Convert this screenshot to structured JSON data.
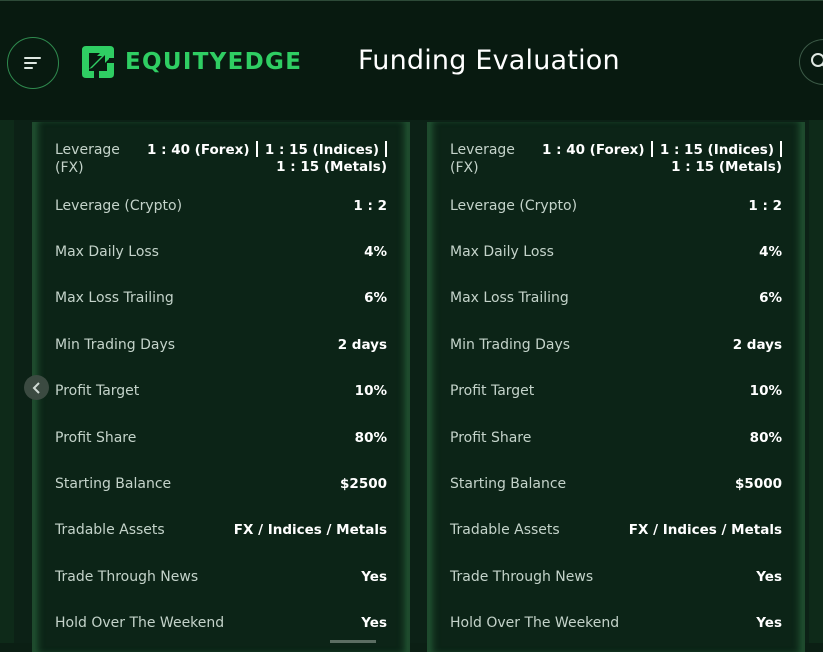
{
  "header": {
    "logo_text": "EQUITYEDGE",
    "page_title": "Funding Evaluation",
    "menu_icon": "hamburger-menu-icon",
    "search_icon": "search-icon"
  },
  "colors": {
    "brand_green": "#2fce63",
    "background": "#0b1f14",
    "header_bg": "#081a10"
  },
  "cards": [
    {
      "leverage_fx": {
        "label": "Leverage (FX)",
        "forex": "1 : 40 (Forex)",
        "indices": "1 : 15 (Indices)",
        "metals": "1 : 15 (Metals)"
      },
      "rows": [
        {
          "label": "Leverage (Crypto)",
          "value": "1 : 2"
        },
        {
          "label": "Max Daily Loss",
          "value": "4%"
        },
        {
          "label": "Max Loss Trailing",
          "value": "6%"
        },
        {
          "label": "Min Trading Days",
          "value": "2 days"
        },
        {
          "label": "Profit Target",
          "value": "10%"
        },
        {
          "label": "Profit Share",
          "value": "80%"
        },
        {
          "label": "Starting Balance",
          "value": "$2500"
        },
        {
          "label": "Tradable Assets",
          "value": "FX / Indices / Metals"
        },
        {
          "label": "Trade Through News",
          "value": "Yes"
        },
        {
          "label": "Hold Over The Weekend",
          "value": "Yes"
        }
      ]
    },
    {
      "leverage_fx": {
        "label": "Leverage (FX)",
        "forex": "1 : 40 (Forex)",
        "indices": "1 : 15 (Indices)",
        "metals": "1 : 15 (Metals)"
      },
      "rows": [
        {
          "label": "Leverage (Crypto)",
          "value": "1 : 2"
        },
        {
          "label": "Max Daily Loss",
          "value": "4%"
        },
        {
          "label": "Max Loss Trailing",
          "value": "6%"
        },
        {
          "label": "Min Trading Days",
          "value": "2 days"
        },
        {
          "label": "Profit Target",
          "value": "10%"
        },
        {
          "label": "Profit Share",
          "value": "80%"
        },
        {
          "label": "Starting Balance",
          "value": "$5000"
        },
        {
          "label": "Tradable Assets",
          "value": "FX / Indices / Metals"
        },
        {
          "label": "Trade Through News",
          "value": "Yes"
        },
        {
          "label": "Hold Over The Weekend",
          "value": "Yes"
        }
      ]
    }
  ]
}
